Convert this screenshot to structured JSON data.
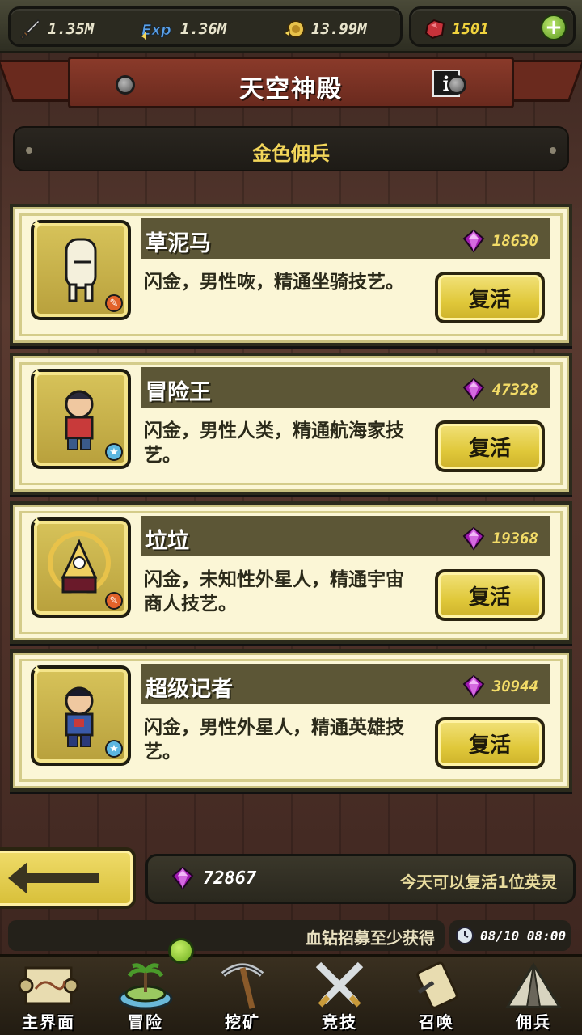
{
  "resources": {
    "attack": "1.35M",
    "exp": "1.36M",
    "gold": "13.99M",
    "gems": "1501",
    "exp_icon_text": "Exp"
  },
  "header": {
    "title": "天空神殿",
    "info_label": "i"
  },
  "section": {
    "title": "金色佣兵"
  },
  "mercenaries": [
    {
      "name": "草泥马",
      "price": "18630",
      "desc": "闪金，男性咴，精通坐骑技艺。",
      "badge": "orange",
      "revive": "复活"
    },
    {
      "name": "冒险王",
      "price": "47328",
      "desc": "闪金，男性人类，精通航海家技艺。",
      "badge": "blue",
      "revive": "复活"
    },
    {
      "name": "垃垃",
      "price": "19368",
      "desc": "闪金，未知性外星人，精通宇宙商人技艺。",
      "badge": "orange",
      "revive": "复活"
    },
    {
      "name": "超级记者",
      "price": "30944",
      "desc": "闪金，男性外星人，精通英雄技艺。",
      "badge": "blue",
      "revive": "复活"
    }
  ],
  "footer": {
    "total_gems": "72867",
    "revive_notice": "今天可以复活1位英灵",
    "ticker": "血钻招募至少获得",
    "time": "08/10 08:00"
  },
  "nav": [
    {
      "label": "主界面",
      "icon": "map-scroll-icon"
    },
    {
      "label": "冒险",
      "icon": "island-icon"
    },
    {
      "label": "挖矿",
      "icon": "pickaxe-icon"
    },
    {
      "label": "竞技",
      "icon": "crossed-swords-icon"
    },
    {
      "label": "召唤",
      "icon": "summon-scroll-icon"
    },
    {
      "label": "佣兵",
      "icon": "tent-icon"
    }
  ],
  "colors": {
    "gold_text": "#f3d65a",
    "card_bg": "#fbf6d6",
    "button_gold": "#e0c83a",
    "gem_purple": "#a01ab0"
  }
}
